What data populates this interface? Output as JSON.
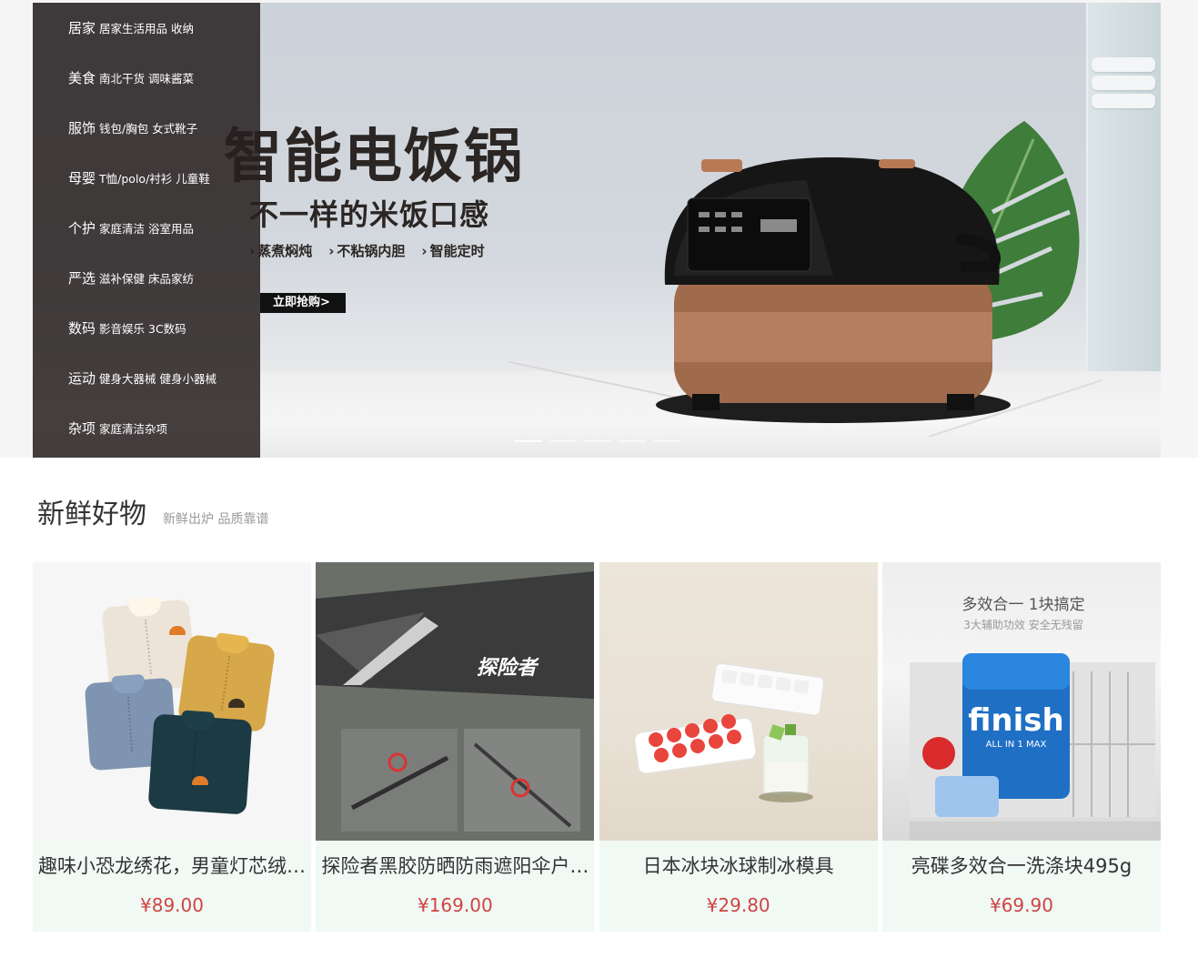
{
  "categories": [
    {
      "main": "居家",
      "sub": "居家生活用品 收纳"
    },
    {
      "main": "美食",
      "sub": "南北干货 调味酱菜"
    },
    {
      "main": "服饰",
      "sub": "钱包/胸包 女式靴子"
    },
    {
      "main": "母婴",
      "sub": "T恤/polo/衬衫 儿童鞋"
    },
    {
      "main": "个护",
      "sub": "家庭清洁 浴室用品"
    },
    {
      "main": "严选",
      "sub": "滋补保健 床品家纺"
    },
    {
      "main": "数码",
      "sub": "影音娱乐 3C数码"
    },
    {
      "main": "运动",
      "sub": "健身大器械 健身小器械"
    },
    {
      "main": "杂项",
      "sub": "家庭清洁杂项"
    }
  ],
  "banner": {
    "title": "智能电饭锅",
    "subtitle": "不一样的米饭口感",
    "features": [
      "蒸煮焖炖",
      "不粘锅内胆",
      "智能定时"
    ],
    "cta": "立即抢购>",
    "slide_count": 5,
    "active_slide": 1
  },
  "section": {
    "title": "新鲜好物",
    "subtitle": "新鲜出炉 品质靠谱"
  },
  "products": [
    {
      "name": "趣味小恐龙绣花，男童灯芯绒…",
      "price": "¥89.00"
    },
    {
      "name": "探险者黑胶防晒防雨遮阳伞户…",
      "price": "¥169.00",
      "print": "探险者"
    },
    {
      "name": "日本冰块冰球制冰模具",
      "price": "¥29.80"
    },
    {
      "name": "亮碟多效合一洗涤块495g",
      "price": "¥69.90",
      "img_headline": "多效合一  1块搞定",
      "img_subline": "3大辅助功效 安全无残留",
      "brand": "finish",
      "brand_tag": "ALL IN 1 MAX"
    }
  ]
}
